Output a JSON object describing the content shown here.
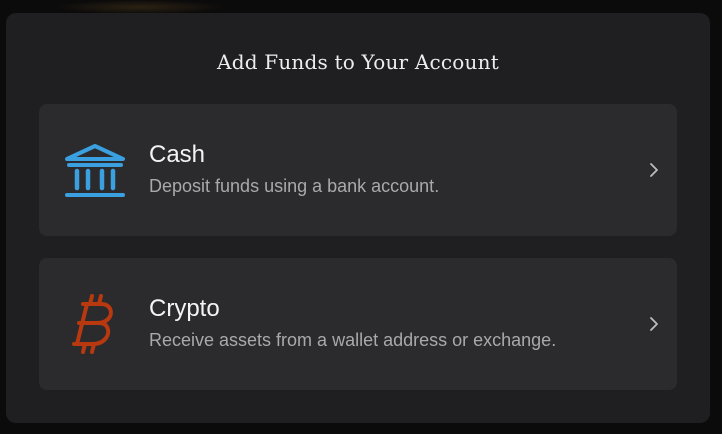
{
  "modal": {
    "title": "Add Funds to Your Account",
    "options": [
      {
        "title": "Cash",
        "description": "Deposit funds using a bank account.",
        "icon": "bank-icon",
        "icon_color": "#3aa0e0"
      },
      {
        "title": "Crypto",
        "description": "Receive assets from a wallet address or exchange.",
        "icon": "bitcoin-icon",
        "icon_color": "#b8380f"
      }
    ]
  }
}
